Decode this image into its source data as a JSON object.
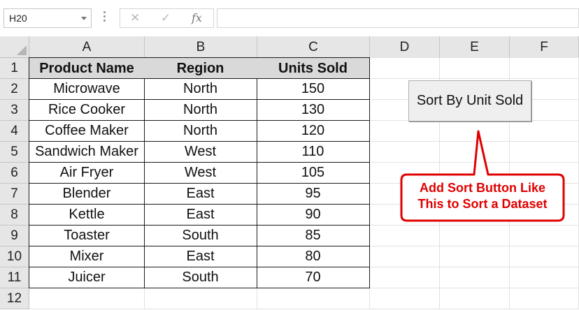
{
  "formula_bar": {
    "name_box": "H20",
    "cancel_icon": "✕",
    "enter_icon": "✓",
    "fx_label": "fx",
    "formula_value": ""
  },
  "columns": [
    "A",
    "B",
    "C",
    "D",
    "E",
    "F"
  ],
  "rows": [
    "1",
    "2",
    "3",
    "4",
    "5",
    "6",
    "7",
    "8",
    "9",
    "10",
    "11",
    "12"
  ],
  "table": {
    "headers": [
      "Product Name",
      "Region",
      "Units Sold"
    ],
    "rows": [
      [
        "Microwave",
        "North",
        "150"
      ],
      [
        "Rice Cooker",
        "North",
        "130"
      ],
      [
        "Coffee Maker",
        "North",
        "120"
      ],
      [
        "Sandwich Maker",
        "West",
        "110"
      ],
      [
        "Air Fryer",
        "West",
        "105"
      ],
      [
        "Blender",
        "East",
        "95"
      ],
      [
        "Kettle",
        "East",
        "90"
      ],
      [
        "Toaster",
        "South",
        "85"
      ],
      [
        "Mixer",
        "East",
        "80"
      ],
      [
        "Juicer",
        "South",
        "70"
      ]
    ]
  },
  "sort_button": {
    "label": "Sort By Unit Sold"
  },
  "callout": {
    "line1": "Add Sort Button Like",
    "line2": "This to Sort a Dataset",
    "color": "#e00000"
  }
}
